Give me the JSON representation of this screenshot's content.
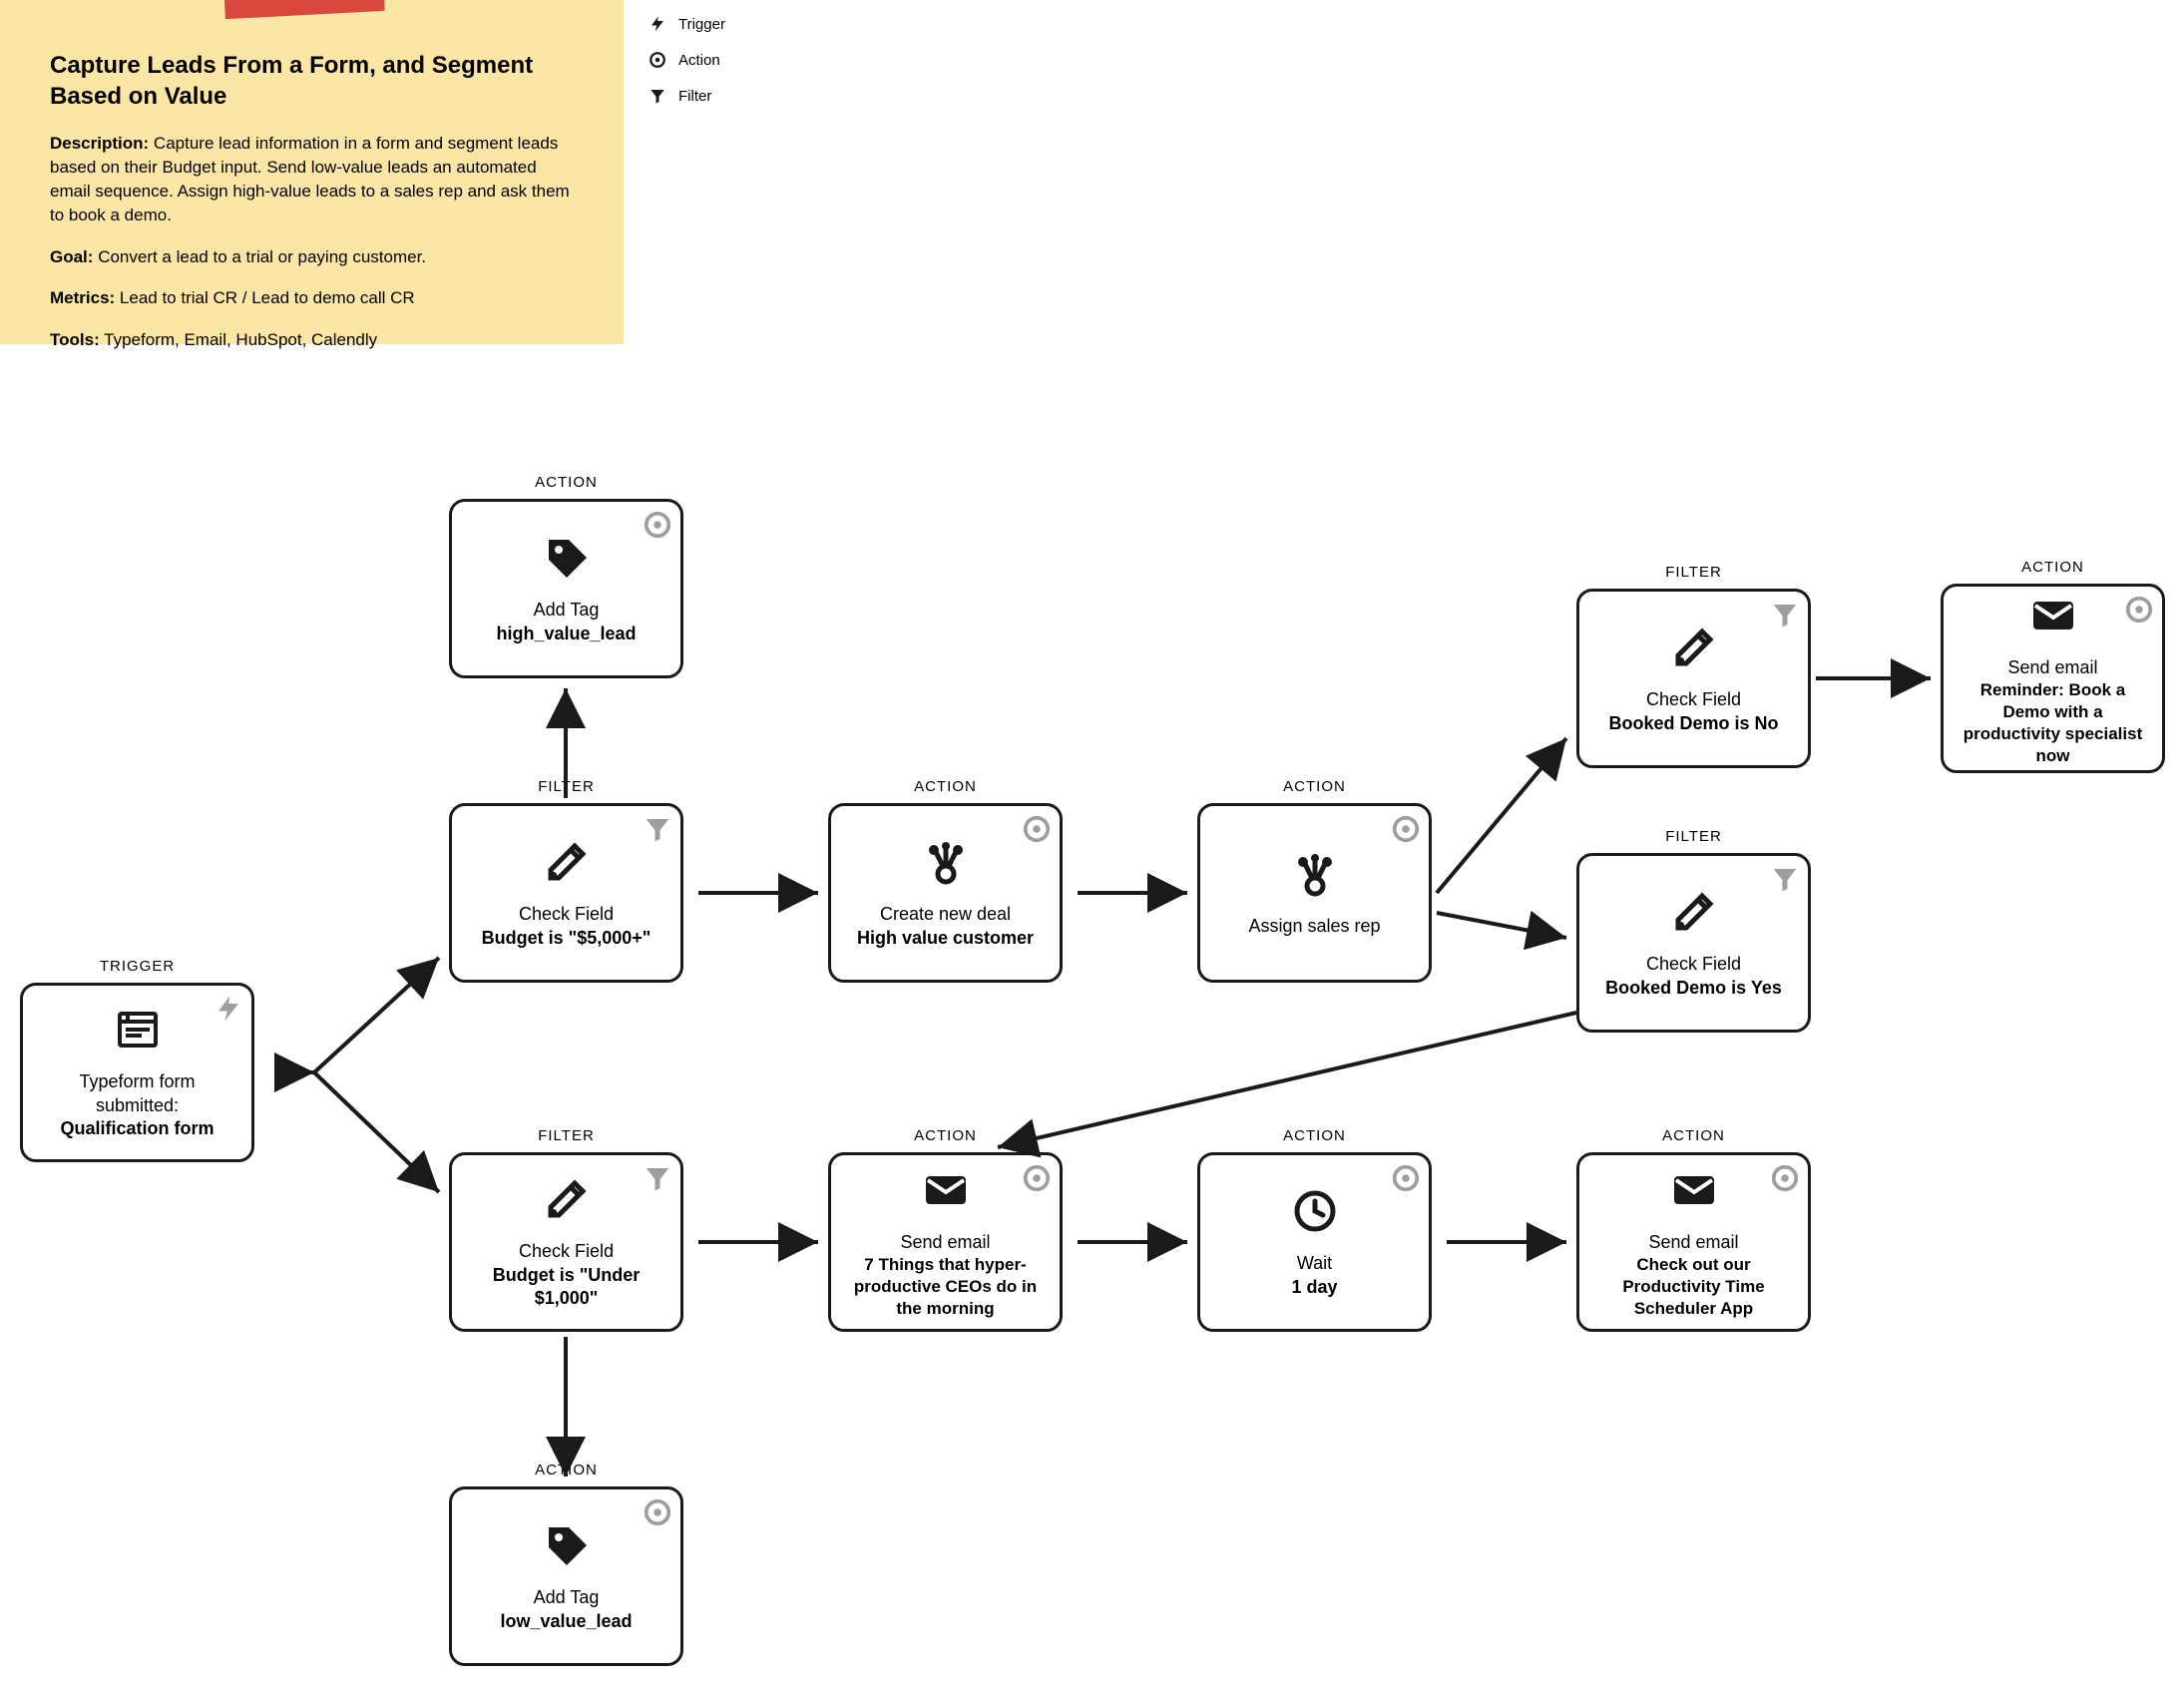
{
  "sticky": {
    "title": "Capture Leads From a Form, and Segment Based on Value",
    "desc_label": "Description:",
    "desc": "Capture lead information in a form and segment leads based on their Budget input. Send low-value leads an automated email sequence. Assign high-value leads to a sales rep and ask them to book a demo.",
    "goal_label": "Goal:",
    "goal": "Convert a lead to a trial or paying customer.",
    "metrics_label": "Metrics:",
    "metrics": "Lead to trial CR / Lead to demo call CR",
    "tools_label": "Tools:",
    "tools": "Typeform, Email, HubSpot, Calendly"
  },
  "legend": {
    "trigger": "Trigger",
    "action": "Action",
    "filter": "Filter"
  },
  "labels": {
    "TRIGGER": "TRIGGER",
    "ACTION": "ACTION",
    "FILTER": "FILTER"
  },
  "nodes": {
    "trigger": {
      "title": "Typeform form submitted:",
      "sub": "Qualification form"
    },
    "filter_high": {
      "title": "Check Field",
      "sub": "Budget is \"$5,000+\""
    },
    "filter_low": {
      "title": "Check Field",
      "sub": "Budget is \"Under $1,000\""
    },
    "tag_high": {
      "title": "Add Tag",
      "sub": "high_value_lead"
    },
    "tag_low": {
      "title": "Add Tag",
      "sub": "low_value_lead"
    },
    "create_deal": {
      "title": "Create new deal",
      "sub": "High value customer"
    },
    "assign_rep": {
      "title": "Assign sales rep",
      "sub": ""
    },
    "filter_demo_no": {
      "title": "Check Field",
      "sub": "Booked Demo is No"
    },
    "filter_demo_yes": {
      "title": "Check Field",
      "sub": "Booked Demo is Yes"
    },
    "email_reminder": {
      "title": "Send email",
      "sub": "Reminder: Book a Demo with a productivity specialist now"
    },
    "email_7things": {
      "title": "Send email",
      "sub": "7 Things that hyper-productive CEOs do in the morning"
    },
    "wait": {
      "title": "Wait",
      "sub": "1 day"
    },
    "email_app": {
      "title": "Send email",
      "sub": "Check out our Productivity Time Scheduler App"
    }
  }
}
